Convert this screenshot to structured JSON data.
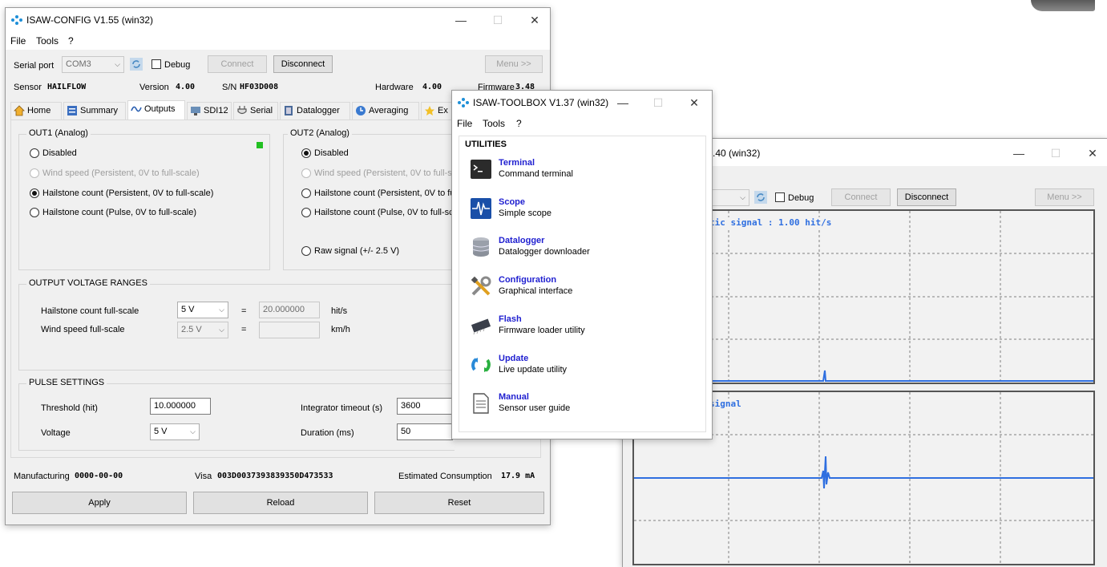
{
  "photo_corner": "gray device photo fragment",
  "config": {
    "title": "ISAW-CONFIG V1.55 (win32)",
    "menu": [
      "File",
      "Tools",
      "?"
    ],
    "serial_port_label": "Serial port",
    "serial_port_value": "COM3",
    "debug_label": "Debug",
    "connect_label": "Connect",
    "disconnect_label": "Disconnect",
    "menu_button_label": "Menu >>",
    "sensor_label": "Sensor",
    "sensor_value": "HAILFLOW",
    "version_label": "Version",
    "version_value": "4.00",
    "sn_label": "S/N",
    "sn_value": "HF03D008",
    "hardware_label": "Hardware",
    "hardware_value": "4.00",
    "firmware_label": "Firmware",
    "firmware_value": "3.48",
    "tabs": [
      "Home",
      "Summary",
      "Outputs",
      "SDI12",
      "Serial",
      "Datalogger",
      "Averaging",
      "Ex"
    ],
    "out1": {
      "title": "OUT1 (Analog)",
      "options": [
        "Disabled",
        "Wind speed (Persistent, 0V to full-scale)",
        "Hailstone count (Persistent, 0V to full-scale)",
        "Hailstone count (Pulse, 0V to full-scale)"
      ],
      "selected": 2,
      "status_color": "#22c022"
    },
    "out2": {
      "title": "OUT2 (Analog)",
      "options": [
        "Disabled",
        "Wind speed (Persistent, 0V to full-sca",
        "Hailstone count (Persistent, 0V to fu",
        "Hailstone count (Pulse, 0V to full-sca",
        "Raw signal (+/- 2.5 V)"
      ],
      "selected": 0
    },
    "voltage_ranges": {
      "title": "OUTPUT VOLTAGE  RANGES",
      "hail_label": "Hailstone count full-scale",
      "hail_range": "5 V",
      "hail_value": "20.000000",
      "hail_unit": "hit/s",
      "wind_label": "Wind speed full-scale",
      "wind_range": "2.5 V",
      "wind_value": "",
      "wind_unit": "km/h",
      "equals": "="
    },
    "pulse": {
      "title": "PULSE SETTINGS",
      "threshold_label": "Threshold (hit)",
      "threshold_value": "10.000000",
      "voltage_label": "Voltage",
      "voltage_value": "5 V",
      "integrator_label": "Integrator timeout (s)",
      "integrator_value": "3600",
      "duration_label": "Duration (ms)",
      "duration_value": "50"
    },
    "footer": {
      "manufacturing_label": "Manufacturing",
      "manufacturing_value": "0000-00-00",
      "visa_label": "Visa",
      "visa_value": "003D0037393839350D473533",
      "consumption_label": "Estimated Consumption",
      "consumption_value": "17.9 mA"
    },
    "apply_label": "Apply",
    "reload_label": "Reload",
    "reset_label": "Reset"
  },
  "toolbox": {
    "title": "ISAW-TOOLBOX V1.37 (win32)",
    "menu": [
      "File",
      "Tools",
      "?"
    ],
    "section": "UTILITIES",
    "tools": [
      {
        "name": "Terminal",
        "desc": "Command terminal",
        "icon": "terminal-icon"
      },
      {
        "name": "Scope",
        "desc": "Simple scope",
        "icon": "scope-icon"
      },
      {
        "name": "Datalogger",
        "desc": "Datalogger downloader",
        "icon": "database-icon"
      },
      {
        "name": "Configuration",
        "desc": "Graphical interface",
        "icon": "tools-icon"
      },
      {
        "name": "Flash",
        "desc": "Firmware loader utility",
        "icon": "chip-icon"
      },
      {
        "name": "Update",
        "desc": "Live update utility",
        "icon": "refresh-icon"
      },
      {
        "name": "Manual",
        "desc": "Sensor user guide",
        "icon": "document-icon"
      }
    ]
  },
  "scope": {
    "title": ".40 (win32)",
    "debug_label": "Debug",
    "connect_label": "Connect",
    "disconnect_label": "Disconnect",
    "menu_button_label": "Menu >>",
    "plot1_label": "tic signal  : 1.00 hit/s",
    "plot2_label": "signal",
    "trace_color": "#2f6fe0"
  }
}
